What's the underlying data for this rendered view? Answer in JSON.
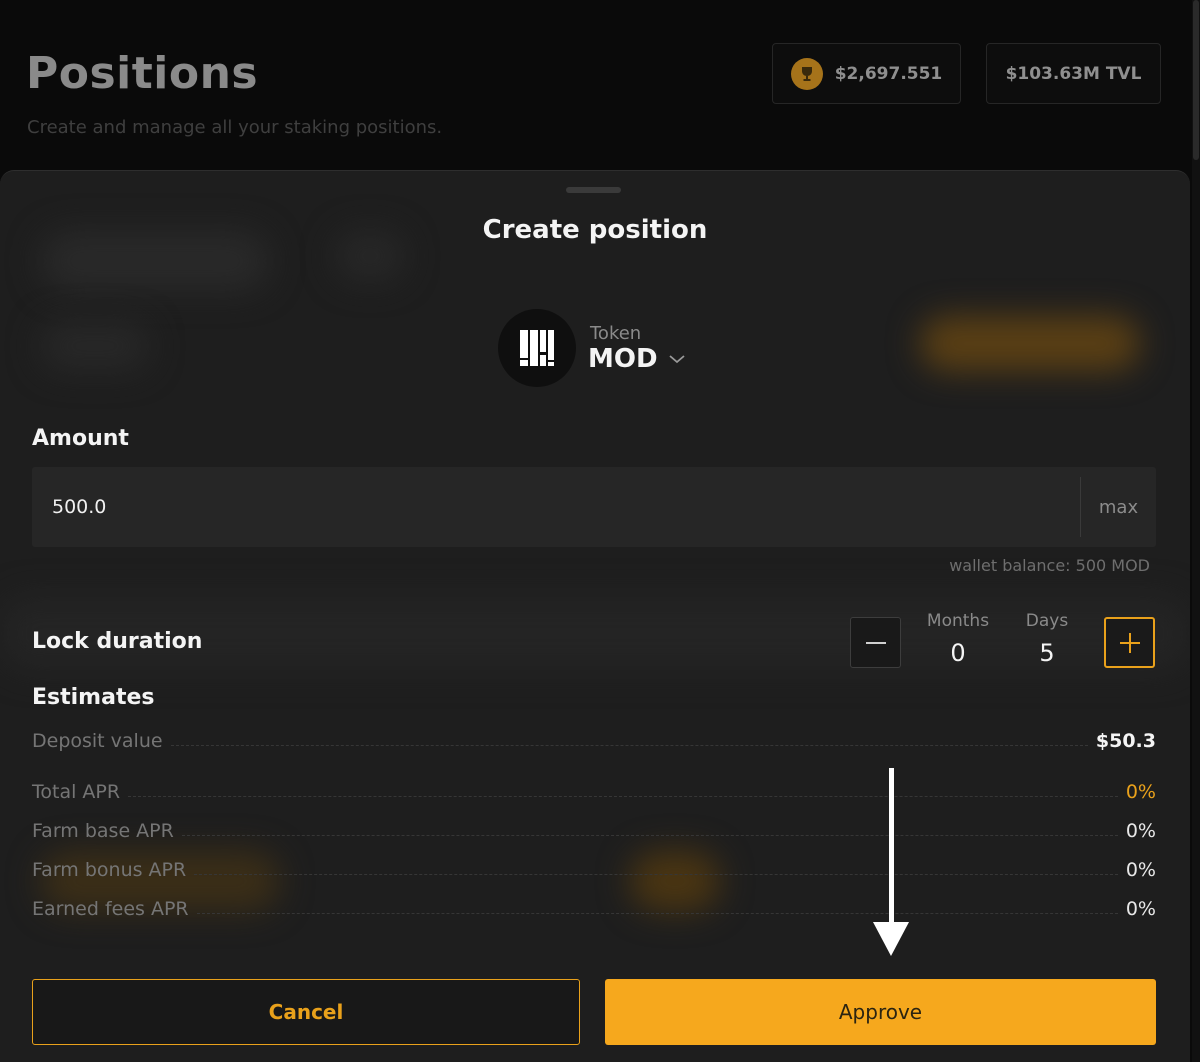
{
  "page": {
    "title": "Positions",
    "subtitle": "Create and manage all your staking positions.",
    "earned_value": "$2,697.551",
    "tvl": "$103.63M TVL"
  },
  "modal": {
    "title": "Create position",
    "token": {
      "caption": "Token",
      "symbol": "MOD"
    },
    "amount": {
      "label": "Amount",
      "value": "500.0",
      "max_label": "max"
    },
    "wallet_balance": "wallet balance:  500 MOD",
    "lock_duration": {
      "label": "Lock duration",
      "months_label": "Months",
      "months_value": "0",
      "days_label": "Days",
      "days_value": "5"
    },
    "estimates": {
      "label": "Estimates",
      "deposit_value": {
        "name": "Deposit value",
        "value": "$50.3"
      },
      "total_apr": {
        "name": "Total APR",
        "value": "0%"
      },
      "farm_base_apr": {
        "name": "Farm base APR",
        "value": "0%"
      },
      "farm_bonus_apr": {
        "name": "Farm bonus APR",
        "value": "0%"
      },
      "earned_fees_apr": {
        "name": "Earned fees APR",
        "value": "0%"
      }
    },
    "cancel_label": "Cancel",
    "approve_label": "Approve"
  },
  "colors": {
    "accent": "#f6a81d",
    "sheet_bg": "#1e1e1e",
    "page_bg": "#0a0a0a"
  },
  "icons": [
    "trophy-icon",
    "mod-logo-icon",
    "chevron-down-icon",
    "minus-icon",
    "plus-icon",
    "arrow-down-icon"
  ]
}
